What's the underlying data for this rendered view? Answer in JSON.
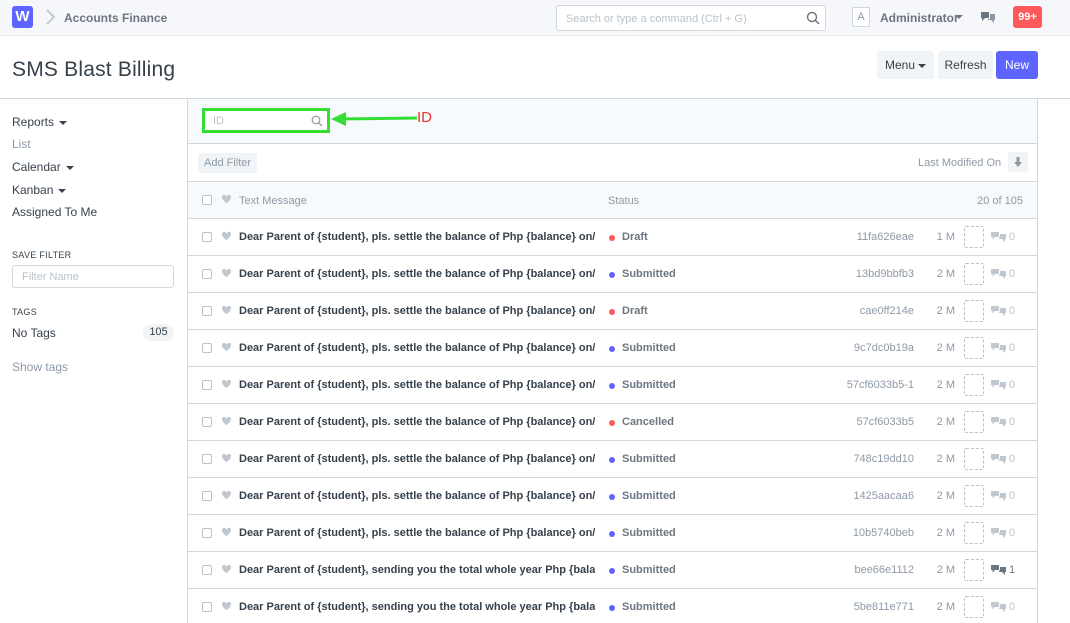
{
  "navbar": {
    "logo_letter": "W",
    "breadcrumb": "Accounts Finance",
    "search_placeholder": "Search or type a command (Ctrl + G)",
    "avatar_letter": "A",
    "user": "Administrator",
    "notifications": "99+"
  },
  "page": {
    "title": "SMS Blast Billing",
    "menu_label": "Menu",
    "refresh_label": "Refresh",
    "new_label": "New"
  },
  "sidebar": {
    "reports": "Reports",
    "list": "List",
    "calendar": "Calendar",
    "kanban": "Kanban",
    "assigned": "Assigned To Me",
    "save_filter_heading": "SAVE FILTER",
    "filter_name_placeholder": "Filter Name",
    "tags_heading": "TAGS",
    "no_tags": "No Tags",
    "no_tags_count": "105",
    "show_tags": "Show tags"
  },
  "filters": {
    "id_placeholder": "ID",
    "annotation_label": "ID",
    "add_filter": "Add Filter",
    "sort_label": "Last Modified On"
  },
  "list": {
    "col_text": "Text Message",
    "col_status": "Status",
    "count_label": "20 of 105",
    "rows": [
      {
        "msg": "Dear Parent of {student}, pls. settle the balance of Php {balance} on/before {due_date} to avoid inconvenience.",
        "status": "Draft",
        "id": "11fa626eae",
        "age": "1 M",
        "comments": "0"
      },
      {
        "msg": "Dear Parent of {student}, pls. settle the balance of Php {balance} on/before {due_date} to avoid inconvenience.",
        "status": "Submitted",
        "id": "13bd9bbfb3",
        "age": "2 M",
        "comments": "0"
      },
      {
        "msg": "Dear Parent of {student}, pls. settle the balance of Php {balance} on/before {due_date} to avoid inconvenience.",
        "status": "Draft",
        "id": "cae0ff214e",
        "age": "2 M",
        "comments": "0"
      },
      {
        "msg": "Dear Parent of {student}, pls. settle the balance of Php {balance} on/before {due_date} to avoid inconvenience.",
        "status": "Submitted",
        "id": "9c7dc0b19a",
        "age": "2 M",
        "comments": "0"
      },
      {
        "msg": "Dear Parent of {student}, pls. settle the balance of Php {balance} on/before {due_date} to avoid inconvenience.",
        "status": "Submitted",
        "id": "57cf6033b5-1",
        "age": "2 M",
        "comments": "0"
      },
      {
        "msg": "Dear Parent of {student}, pls. settle the balance of Php {balance} on/before {due_date} to avoid inconvenience.",
        "status": "Cancelled",
        "id": "57cf6033b5",
        "age": "2 M",
        "comments": "0"
      },
      {
        "msg": "Dear Parent of {student}, pls. settle the balance of Php {balance} on/before {due_date} to avoid inconvenience.",
        "status": "Submitted",
        "id": "748c19dd10",
        "age": "2 M",
        "comments": "0"
      },
      {
        "msg": "Dear Parent of {student}, pls. settle the balance of Php {balance} on/before {due_date} to avoid inconvenience.",
        "status": "Submitted",
        "id": "1425aacaa6",
        "age": "2 M",
        "comments": "0"
      },
      {
        "msg": "Dear Parent of {student}, pls. settle the balance of Php {balance} on/before {due_date} to avoid inconvenience.",
        "status": "Submitted",
        "id": "10b5740beb",
        "age": "2 M",
        "comments": "0"
      },
      {
        "msg": "Dear Parent of {student}, sending you the total whole year Php {balance} statement.",
        "status": "Submitted",
        "id": "bee66e1112",
        "age": "2 M",
        "comments": "1"
      },
      {
        "msg": "Dear Parent of {student}, sending you the total whole year Php {balance} statement.",
        "status": "Submitted",
        "id": "5be811e771",
        "age": "2 M",
        "comments": "0"
      }
    ]
  },
  "colors": {
    "accent": "#5e64ff",
    "draft": "#ff5858",
    "submitted": "#5e64ff",
    "cancelled": "#ff5858",
    "annotation": "#33dd33"
  }
}
